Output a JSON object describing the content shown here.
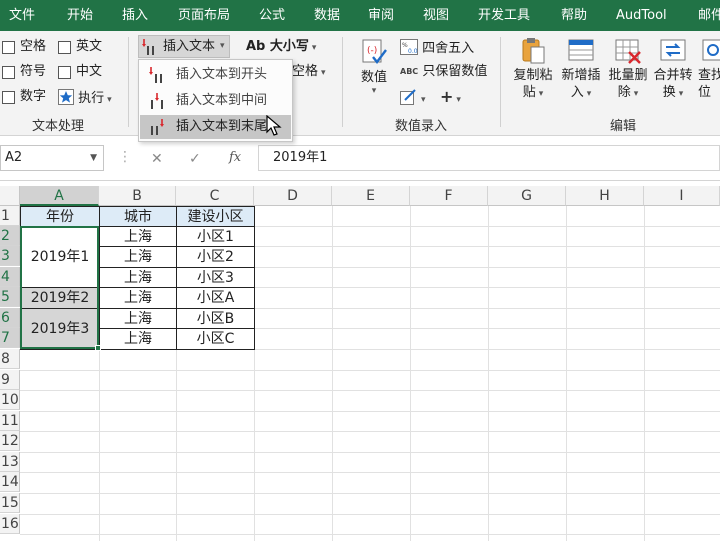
{
  "tabs": [
    "文件",
    "开始",
    "插入",
    "页面布局",
    "公式",
    "数据",
    "审阅",
    "视图",
    "开发工具",
    "帮助",
    "AudTool",
    "邮件"
  ],
  "colors": {
    "accent": "#217346",
    "header_fill": "#ddebf7",
    "merged_fill": "#d6d6d6"
  },
  "ribbon": {
    "text_group": {
      "checkboxes": [
        "空格",
        "英文",
        "符号",
        "中文",
        "数字"
      ],
      "exec_label": "执行",
      "label": "文本处理"
    },
    "insert_text_label": "插入文本",
    "case_label": "Ab 大小写",
    "space_label": "空格",
    "number_group": {
      "value_btn": "数值",
      "round_btn": "四舍五入",
      "keep_numeric": "只保留数值",
      "abc_tag": "ABC",
      "label": "数值录入"
    },
    "edit_group": {
      "buttons": [
        [
          "复制粘",
          "贴"
        ],
        [
          "新增插",
          "入"
        ],
        [
          "批量删",
          "除"
        ],
        [
          "合并转",
          "换"
        ],
        [
          "查找",
          "位"
        ]
      ],
      "label": "编辑"
    }
  },
  "dropdown": {
    "items": [
      "插入文本到开头",
      "插入文本到中间",
      "插入文本到末尾"
    ],
    "hovered_index": 2
  },
  "formula_bar": {
    "name_box": "A2",
    "formula": "2019年1",
    "fx_label": "fx"
  },
  "grid": {
    "columns": [
      "A",
      "B",
      "C",
      "D",
      "E",
      "F",
      "G",
      "H",
      "I"
    ],
    "rows": [
      "1",
      "2",
      "3",
      "4",
      "5",
      "6",
      "7",
      "8",
      "9",
      "10",
      "11",
      "12",
      "13",
      "14",
      "15",
      "16"
    ],
    "selected_column": "A",
    "selected_rows": [
      "2",
      "3",
      "4",
      "5",
      "6",
      "7"
    ],
    "header_row": [
      "年份",
      "城市",
      "建设小区"
    ],
    "year_groups": [
      "2019年1",
      "2019年2",
      "2019年3"
    ],
    "cities": [
      "上海",
      "上海",
      "上海",
      "上海",
      "上海",
      "上海"
    ],
    "districts": [
      "小区1",
      "小区2",
      "小区3",
      "小区A",
      "小区B",
      "小区C"
    ]
  }
}
